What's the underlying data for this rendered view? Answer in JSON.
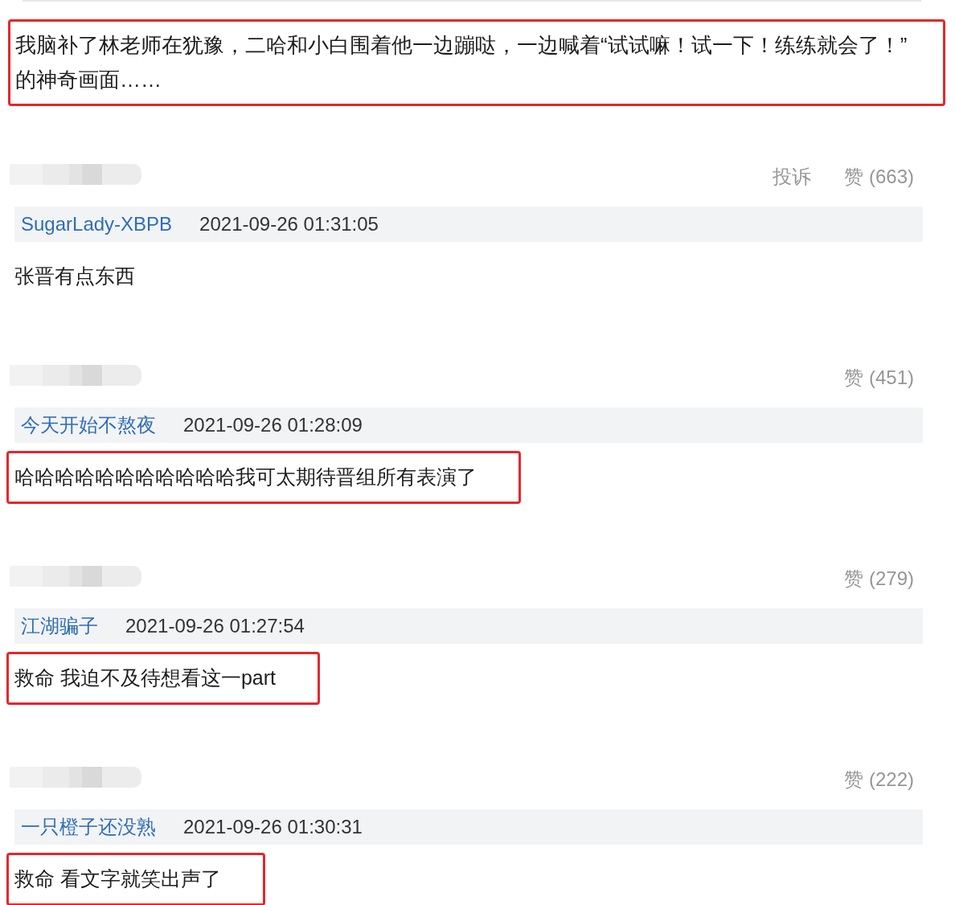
{
  "top_comment": {
    "text": "我脑补了林老师在犹豫，二哈和小白围着他一边蹦哒，一边喊着“试试嘛！试一下！练练就会了！”的神奇画面……",
    "highlighted": true
  },
  "comments": [
    {
      "report": "投诉",
      "likes": "赞 (663)",
      "username": "SugarLady-XBPB",
      "time": "2021-09-26 01:31:05",
      "text": "张晋有点东西",
      "highlighted": false
    },
    {
      "likes": "赞 (451)",
      "username": "今天开始不熬夜",
      "time": "2021-09-26 01:28:09",
      "text": "哈哈哈哈哈哈哈哈哈哈哈我可太期待晋组所有表演了",
      "highlighted": true
    },
    {
      "likes": "赞 (279)",
      "username": "江湖骗子",
      "time": "2021-09-26 01:27:54",
      "text": "救命 我迫不及待想看这一part",
      "highlighted": true
    },
    {
      "likes": "赞 (222)",
      "username": "一只橙子还没熟",
      "time": "2021-09-26 01:30:31",
      "text": "救命 看文字就笑出声了",
      "highlighted": true
    }
  ]
}
